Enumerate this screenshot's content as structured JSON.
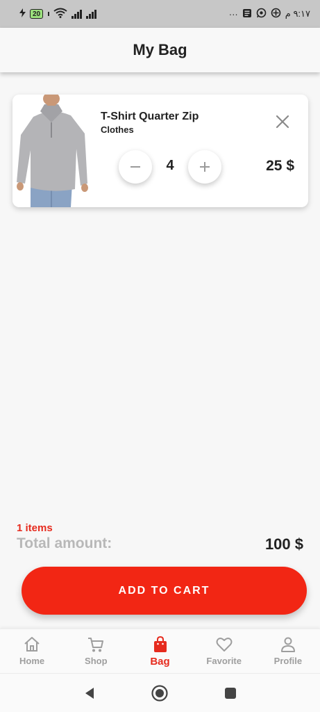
{
  "status_bar": {
    "time": "٩:١٧ م",
    "battery": "20",
    "more": "···",
    "icons": [
      "charging-icon",
      "battery-icon",
      "wifi-icon",
      "signal-icon",
      "news-icon",
      "whatsapp-icon",
      "location-icon"
    ]
  },
  "header": {
    "title": "My Bag"
  },
  "cart": {
    "items": [
      {
        "name": "T-Shirt Quarter Zip",
        "category": "Clothes",
        "quantity": "4",
        "price": "25 $",
        "image": "grey-quarter-zip-shirt"
      }
    ]
  },
  "summary": {
    "items_count": "1 items",
    "total_label": "Total amount:",
    "total_value": "100  $"
  },
  "cta": {
    "label": "ADD TO CART"
  },
  "bottom_nav": {
    "items": [
      {
        "label": "Home",
        "icon": "home-icon"
      },
      {
        "label": "Shop",
        "icon": "cart-icon"
      },
      {
        "label": "Bag",
        "icon": "bag-icon",
        "active": true
      },
      {
        "label": "Favorite",
        "icon": "heart-icon"
      },
      {
        "label": "Profile",
        "icon": "profile-icon"
      }
    ]
  },
  "colors": {
    "accent": "#f22614",
    "accent_text": "#e62b1e",
    "inactive": "#9e9e9e",
    "background": "#f7f7f7"
  }
}
